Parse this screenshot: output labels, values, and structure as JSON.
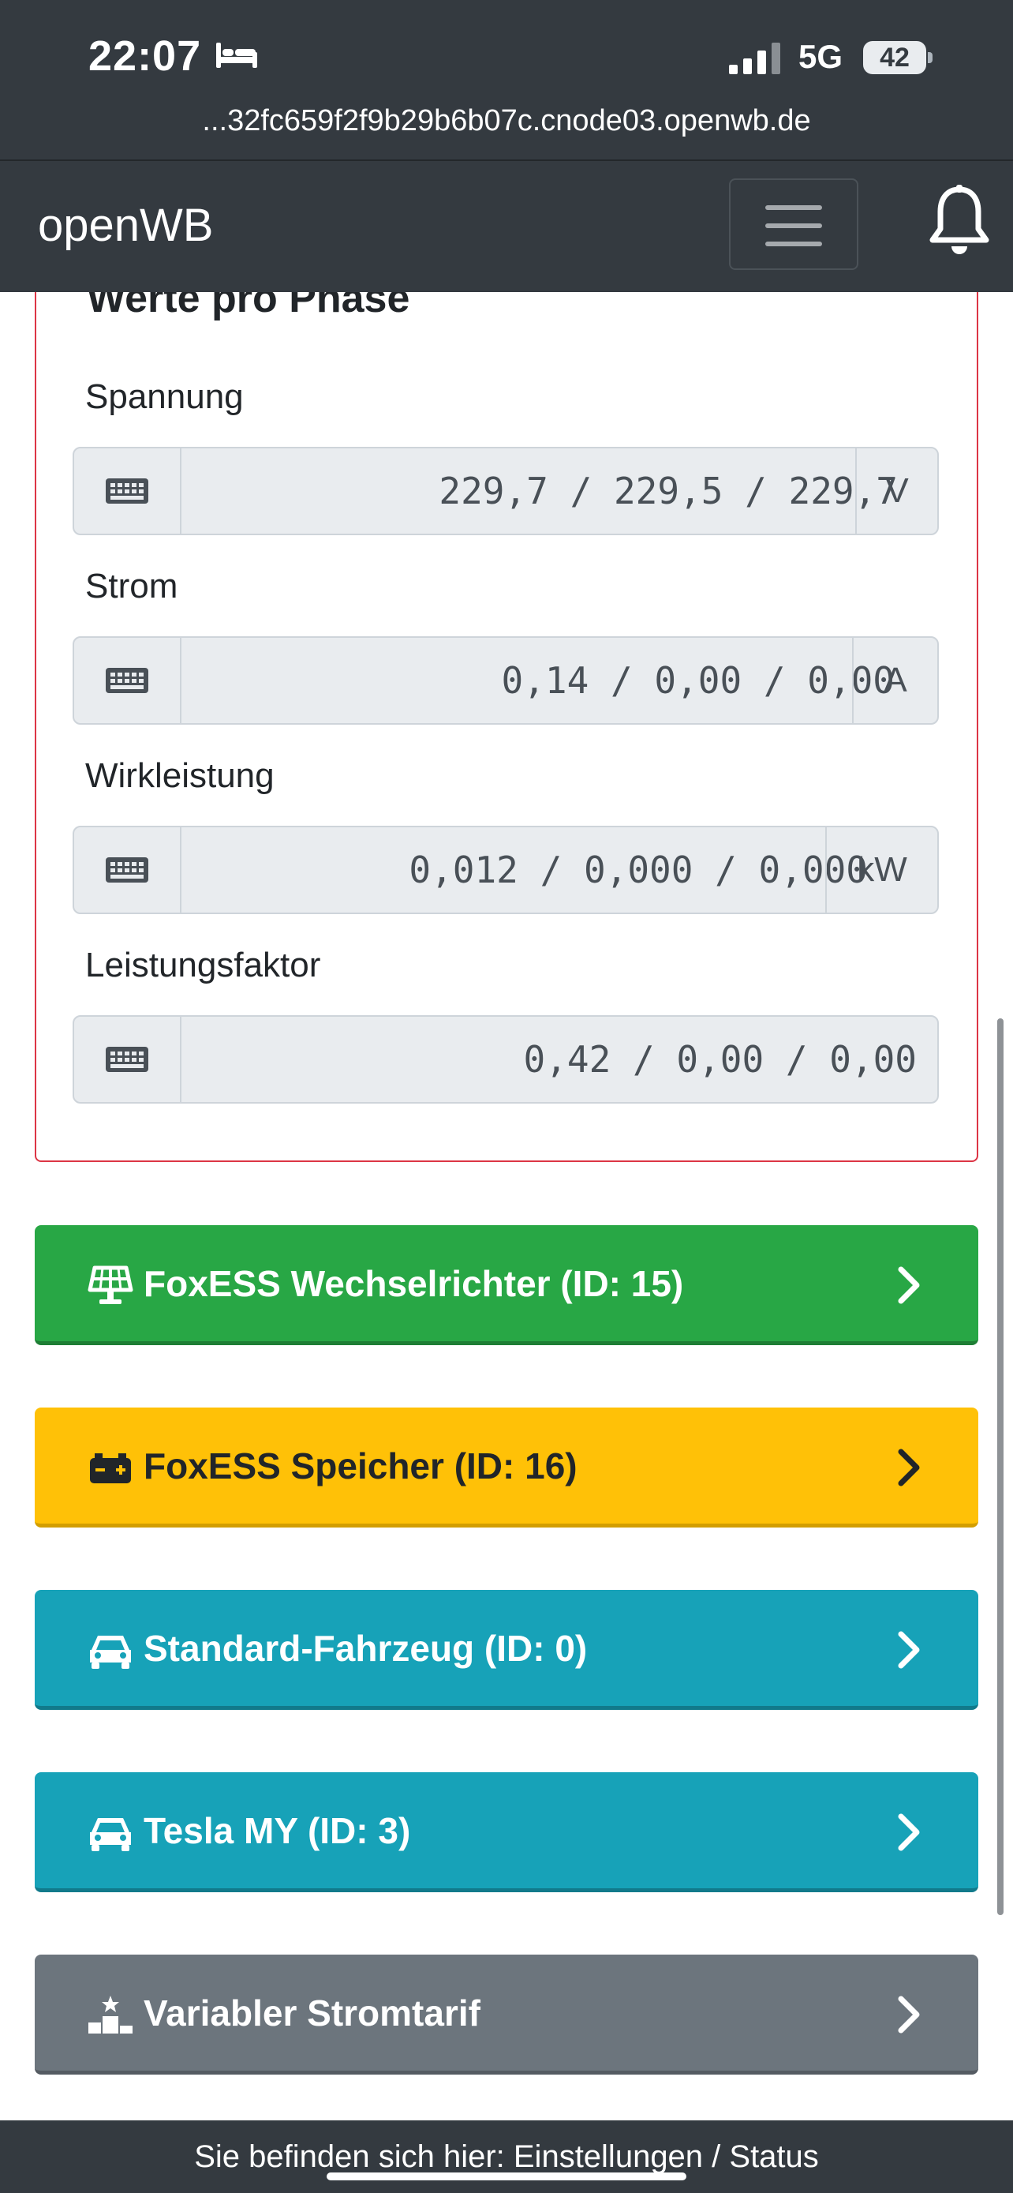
{
  "status_bar": {
    "time": "22:07",
    "network": "5G",
    "battery": "42",
    "url": "...32fc659f2f9b29b6b07c.cnode03.openwb.de"
  },
  "navbar": {
    "brand": "openWB"
  },
  "phase_card": {
    "title": "Werte pro Phase",
    "fields": [
      {
        "label": "Spannung",
        "value": "229,7 / 229,5 / 229,7",
        "unit": "V"
      },
      {
        "label": "Strom",
        "value": "0,14 / 0,00 / 0,00",
        "unit": "A"
      },
      {
        "label": "Wirkleistung",
        "value": "0,012 / 0,000 / 0,000",
        "unit": "kW"
      },
      {
        "label": "Leistungsfaktor",
        "value": "0,42 / 0,00 / 0,00",
        "unit": ""
      }
    ]
  },
  "components": [
    {
      "label": "FoxESS Wechselrichter (ID: 15)",
      "icon": "solar-panel-icon",
      "color": "#28a745"
    },
    {
      "label": "FoxESS Speicher (ID: 16)",
      "icon": "car-battery-icon",
      "color": "#ffc107"
    },
    {
      "label": "Standard-Fahrzeug (ID: 0)",
      "icon": "car-icon",
      "color": "#17a2b8"
    },
    {
      "label": "Tesla MY (ID: 3)",
      "icon": "car-icon",
      "color": "#17a2b8"
    },
    {
      "label": "Variabler Stromtarif",
      "icon": "ranking-star-icon",
      "color": "#6c757d"
    }
  ],
  "footer": {
    "text": "Sie befinden sich hier: Einstellungen / Status"
  }
}
